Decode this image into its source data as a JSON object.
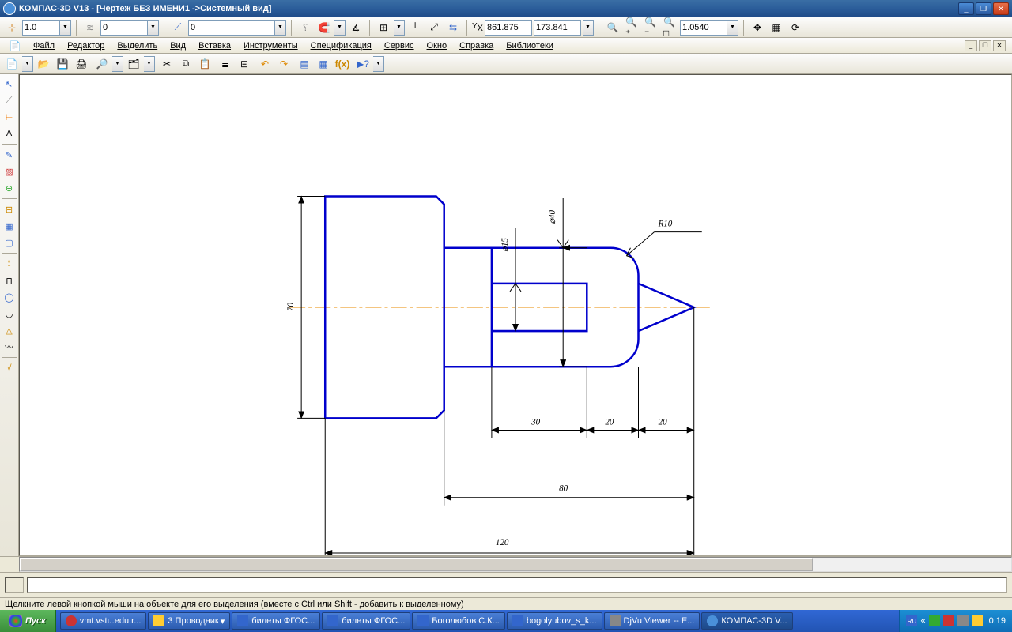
{
  "titlebar": {
    "text": "КОМПАС-3D V13 - [Чертеж БЕЗ ИМЕНИ1 ->Системный вид]"
  },
  "toolbar1": {
    "scale_current": "1.0",
    "layer": "0",
    "style_num": "0",
    "coord_x": "861.875",
    "coord_y": "173.841",
    "zoom": "1.0540"
  },
  "menubar": [
    "Файл",
    "Редактор",
    "Выделить",
    "Вид",
    "Вставка",
    "Инструменты",
    "Спецификация",
    "Сервис",
    "Окно",
    "Справка",
    "Библиотеки"
  ],
  "drawing": {
    "dims": {
      "height70": "70",
      "dia40": "⌀40",
      "dia15": "⌀15",
      "r10": "R10",
      "len30": "30",
      "len20a": "20",
      "len20b": "20",
      "len80": "80",
      "len120": "120"
    }
  },
  "statusbar": {
    "hint": "Щелкните левой кнопкой мыши на объекте для его выделения (вместе с Ctrl или Shift - добавить к выделенному)"
  },
  "taskbar": {
    "start": "Пуск",
    "items": [
      {
        "label": "vmt.vstu.edu.r..."
      },
      {
        "label": "3 Проводник"
      },
      {
        "label": "билеты ФГОС..."
      },
      {
        "label": "билеты ФГОС..."
      },
      {
        "label": "Боголюбов С.К..."
      },
      {
        "label": "bogolyubov_s_k..."
      },
      {
        "label": "DjVu Viewer -- E..."
      },
      {
        "label": "КОМПАС-3D V..."
      }
    ],
    "lang": "RU",
    "clock": "0:19"
  }
}
